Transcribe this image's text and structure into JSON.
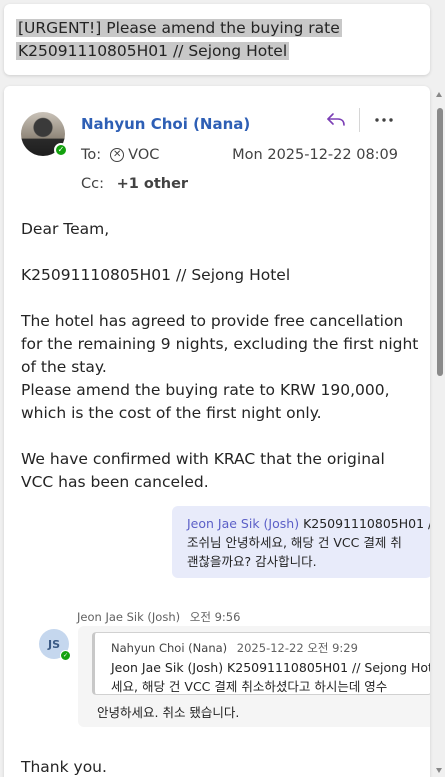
{
  "subject": {
    "line1": "[URGENT!] Please amend the buying rate",
    "line2": "K25091110805H01 // Sejong Hotel"
  },
  "message": {
    "sender": "Nahyun Choi (Nana)",
    "to_label": "To:",
    "to_recipient": "VOC",
    "date": "Mon 2025-12-22 08:09",
    "cc_label": "Cc:",
    "cc_other": "+1 other",
    "body": [
      "Dear Team,",
      "",
      "K25091110805H01 // Sejong Hotel",
      "",
      "The hotel has agreed to provide free cancellation",
      "for the remaining 9 nights, excluding the first night",
      "of the stay.",
      "Please amend the buying rate to KRW 190,000,",
      "which is the cost of the first night only.",
      "",
      "We have confirmed with KRAC that the original",
      "VCC has been canceled."
    ],
    "closing": "Thank you."
  },
  "chat": {
    "right_bubble": {
      "name": "Jeon Jae Sik (Josh)",
      "ref": "K25091110805H01 //",
      "line1": "조쉬님 안녕하세요, 해당 건 VCC 결제 취",
      "line2": "괜찮을까요? 감사합니다."
    },
    "left": {
      "sender": "Jeon Jae Sik (Josh)",
      "time": "오전 9:56",
      "avatar_initials": "JS",
      "quote_name": "Nahyun Choi (Nana)",
      "quote_date": "2025-12-22 오전 9:29",
      "quote_line1": "Jeon Jae Sik (Josh) K25091110805H01 // Sejong Hot",
      "quote_line2": "세요, 해당 건 VCC 결제 취소하셨다고 하시는데 영수",
      "reply": "안녕하세요. 취소 됐습니다."
    }
  },
  "icons": {
    "reply": "reply-arrow-icon",
    "more": "more-horizontal-icon",
    "recipient": "group-circle-x-icon",
    "presence": "presence-available-icon"
  },
  "colors": {
    "sender_link": "#2e5fb5",
    "reply_icon": "#7b3fb5",
    "presence": "#13a10e",
    "chat_bubble_right": "#e8ebfa",
    "chat_name": "#5b5fc7"
  }
}
